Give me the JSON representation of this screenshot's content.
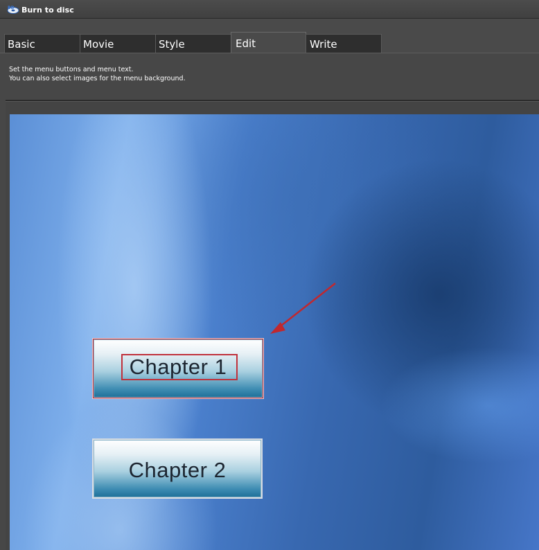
{
  "window": {
    "title": "Burn to disc",
    "icon": "disc-burn-icon"
  },
  "tabs": [
    {
      "label": "Basic",
      "active": false
    },
    {
      "label": "Movie",
      "active": false
    },
    {
      "label": "Style",
      "active": false
    },
    {
      "label": "Edit",
      "active": true
    },
    {
      "label": "Write",
      "active": false
    }
  ],
  "description": {
    "line1": "Set the menu buttons and menu text.",
    "line2": "You can also select images for the menu background."
  },
  "preview": {
    "buttons": [
      {
        "label": "Chapter 1",
        "selected": true
      },
      {
        "label": "Chapter 2",
        "selected": false
      }
    ],
    "selection_color": "#c0303a",
    "annotation": "arrow pointing to selected button"
  },
  "colors": {
    "window_bg": "#474747",
    "tab_bg": "#2e2e2e",
    "text": "#ffffff",
    "highlight": "#c0303a"
  }
}
